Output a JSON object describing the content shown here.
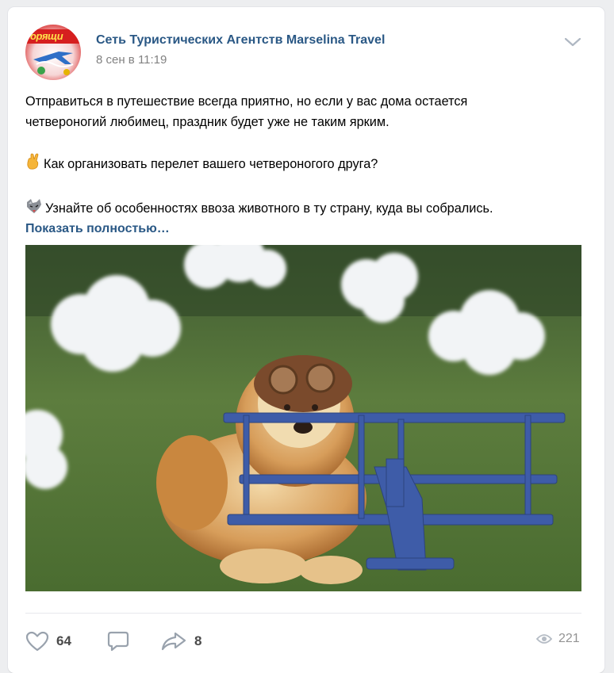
{
  "post": {
    "author": "Сеть Туристических Агентств Marselina Travel",
    "date": "8 сен в 11:19",
    "avatar_text": "орящи",
    "lines": [
      "Отправиться в путешествие всегда приятно, но если у вас дома остается",
      "четвероногий любимец, праздник будет уже не таким ярким.",
      "Как организовать перелет вашего четвероногого друга?",
      "Узнайте об особенностях ввоза животного в ту страну, куда вы собрались."
    ],
    "line_emojis": [
      "crossed-fingers-icon",
      "wolf-icon"
    ],
    "show_more": "Показать полностью…"
  },
  "actions": {
    "likes": "64",
    "shares": "8",
    "views": "221"
  },
  "colors": {
    "link": "#2a5885",
    "meta": "#828282",
    "background": "#edeef0"
  }
}
